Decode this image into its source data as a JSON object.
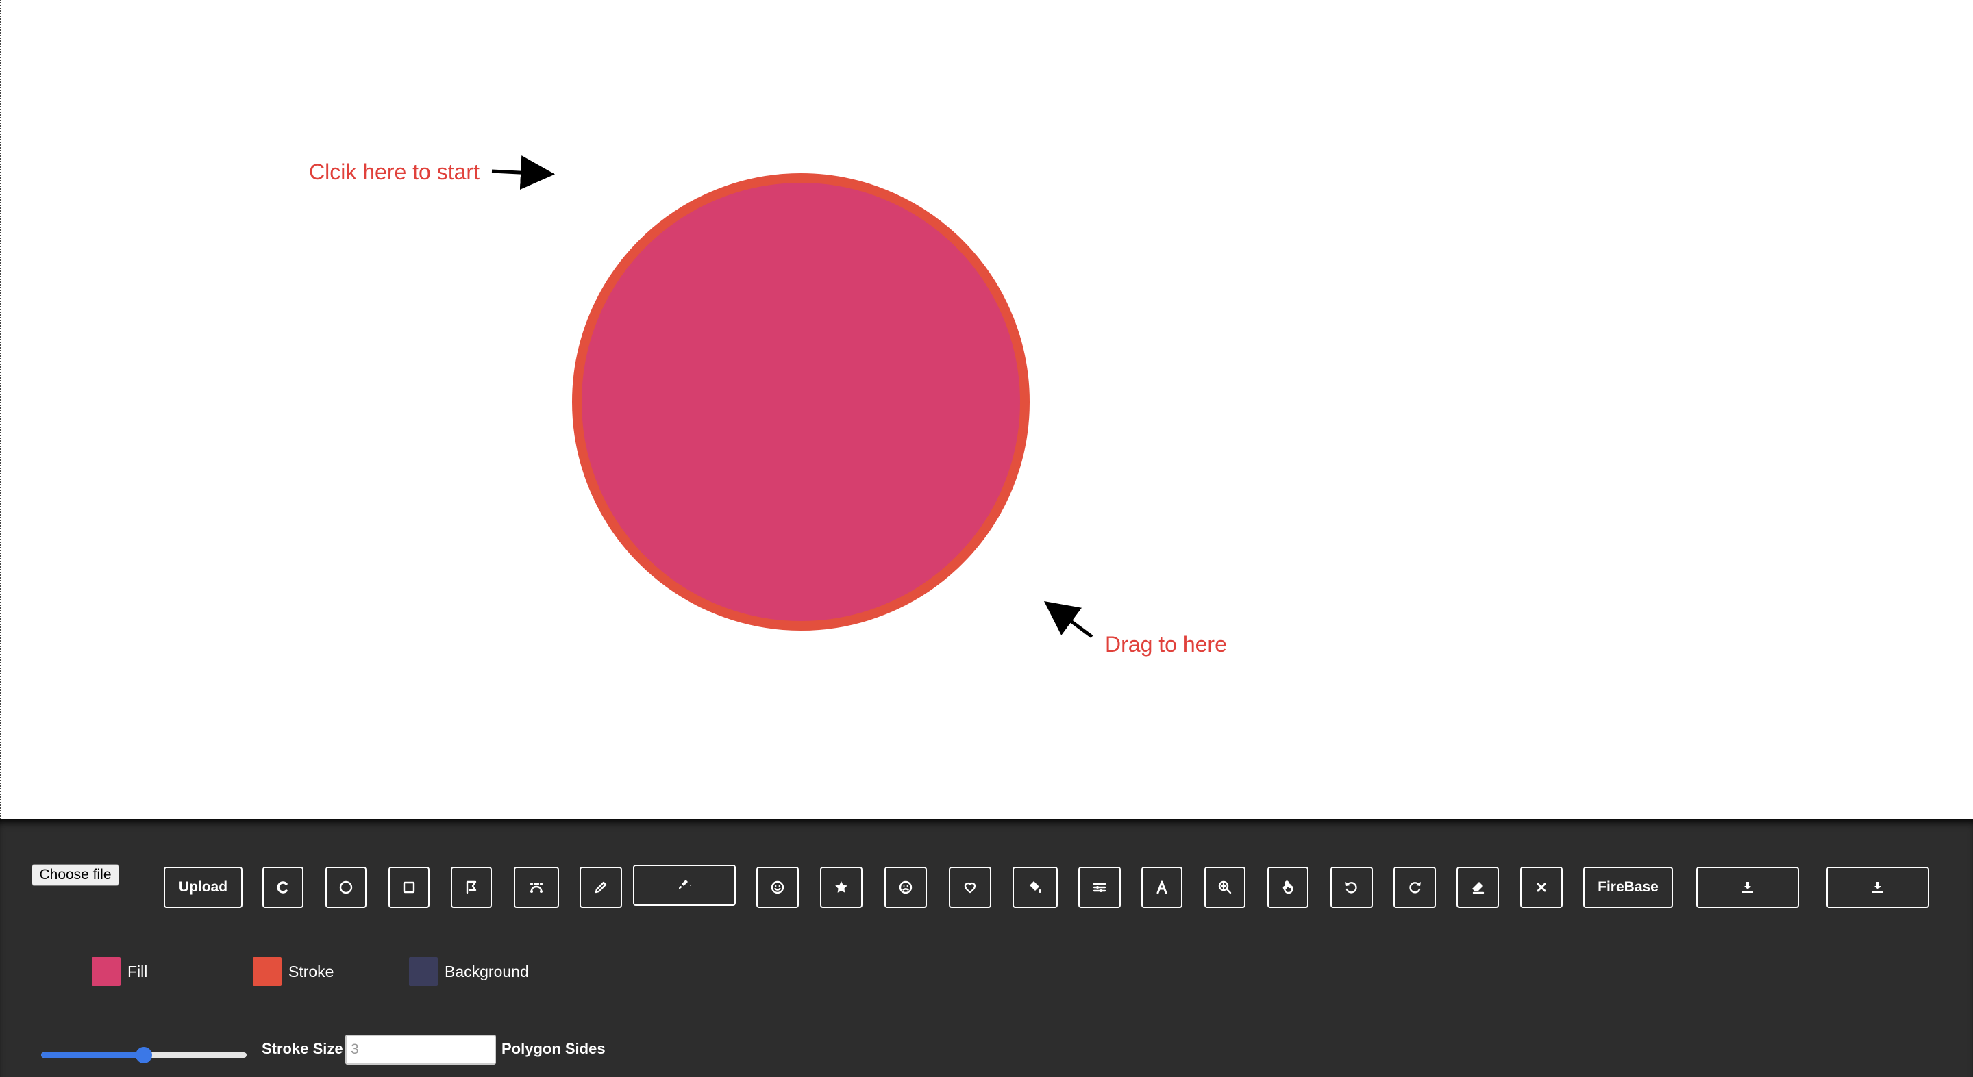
{
  "canvas": {
    "hint_start": "Clcik here to start",
    "hint_drag": "Drag to here",
    "circle_fill": "#d63f6e",
    "circle_stroke": "#e3503d"
  },
  "toolbar": {
    "choose_file_label": "Choose file",
    "upload_label": "Upload",
    "firebase_label": "FireBase",
    "buttons": [
      {
        "name": "reset-icon"
      },
      {
        "name": "circle-icon"
      },
      {
        "name": "square-icon"
      },
      {
        "name": "polygon-icon"
      },
      {
        "name": "bezier-icon"
      },
      {
        "name": "pencil-icon"
      },
      {
        "name": "brush-dropdown-icon"
      },
      {
        "name": "emoji-icon"
      },
      {
        "name": "star-icon"
      },
      {
        "name": "face-icon"
      },
      {
        "name": "heart-icon"
      },
      {
        "name": "fill-bucket-icon"
      },
      {
        "name": "sliders-icon"
      },
      {
        "name": "text-icon"
      },
      {
        "name": "zoom-icon"
      },
      {
        "name": "hand-icon"
      },
      {
        "name": "undo-icon"
      },
      {
        "name": "redo-icon"
      },
      {
        "name": "eraser-icon"
      },
      {
        "name": "close-icon"
      },
      {
        "name": "download-icon"
      }
    ]
  },
  "colors": {
    "fill_label": "Fill",
    "fill_color": "#d63f6e",
    "stroke_label": "Stroke",
    "stroke_color": "#e3503d",
    "background_label": "Background",
    "background_color": "#3b3d5c"
  },
  "controls": {
    "stroke_size_label": "Stroke Size",
    "stroke_size_fraction": 0.5,
    "polygon_placeholder": "3",
    "polygon_sides_label": "Polygon Sides"
  }
}
